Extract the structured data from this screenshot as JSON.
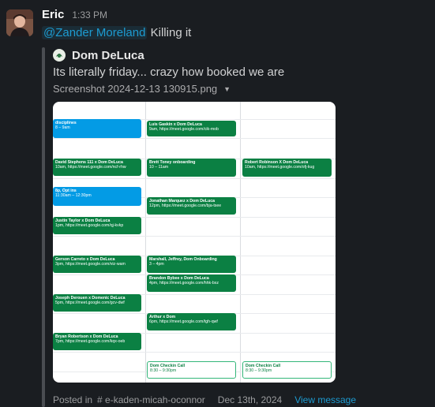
{
  "message": {
    "username": "Eric",
    "time": "1:33 PM",
    "mention": "@Zander Moreland",
    "text": "Killing it"
  },
  "quote": {
    "author": "Dom DeLuca",
    "text": "Its literally friday... crazy how booked we are",
    "attachment_name": "Screenshot 2024-12-13 130915.png"
  },
  "calendar": {
    "col1": [
      {
        "title": "disciplines",
        "sub": "8 – 9am",
        "color": "blue"
      },
      {
        "title": "David Stephens 111 x Dom DeLuca",
        "sub": "10am, https://meet.google.com/ncf-rhw",
        "color": "green"
      },
      {
        "title": "8p, Opt ins",
        "sub": "11:30am – 12:30pm",
        "color": "blue"
      },
      {
        "title": "Justin Taylor x Dom DeLuca",
        "sub": "1pm, https://meet.google.com/qj-kvkp",
        "color": "green"
      },
      {
        "title": "Gerson Carreto x Dom DeLuca",
        "sub": "3pm, https://meet.google.com/viz-wam",
        "color": "green"
      },
      {
        "title": "Joseph Derouen x Domenic DeLuca",
        "sub": "5pm, https://meet.google.com/gcv-dwf",
        "color": "green"
      },
      {
        "title": "Bryan Robertson x Dom DeLuca",
        "sub": "7pm, https://meet.google.com/kqx-oeb",
        "color": "green"
      }
    ],
    "col2": [
      {
        "title": "Luis Gaskin x Dom DeLuca",
        "sub": "9am, https://meet.google.com/cik-mob",
        "color": "green"
      },
      {
        "title": "Brett Toney onboarding",
        "sub": "10 – 11am",
        "color": "green"
      },
      {
        "title": "Jonathan Marquez x Dom DeLuca",
        "sub": "12pm, https://meet.google.com/bja-tsee",
        "color": "green"
      },
      {
        "title": "Marshall, Jeffrey, Dom Onboarding",
        "sub": "3 – 4pm",
        "color": "green"
      },
      {
        "title": "Brandon Bybee x Dom DeLuca",
        "sub": "4pm, https://meet.google.com/hhk-bxz",
        "color": "green"
      },
      {
        "title": "Arthur x Dom",
        "sub": "6pm, https://meet.google.com/tgh-qwf",
        "color": "green"
      },
      {
        "title": "Dom Checkin Call",
        "sub": "8:30 – 9:30pm",
        "color": "outline"
      }
    ],
    "col3": [
      {
        "title": "Robert Robinson X Dom DeLuca",
        "sub": "10am, https://meet.google.com/ofj-kug",
        "color": "green"
      },
      {
        "title": "Dom Checkin Call",
        "sub": "8:30 – 9:30pm",
        "color": "outline"
      }
    ]
  },
  "footer": {
    "posted_in": "Posted in",
    "channel": "# e-kaden-micah-oconnor",
    "date": "Dec 13th, 2024",
    "view_message": "View message"
  }
}
